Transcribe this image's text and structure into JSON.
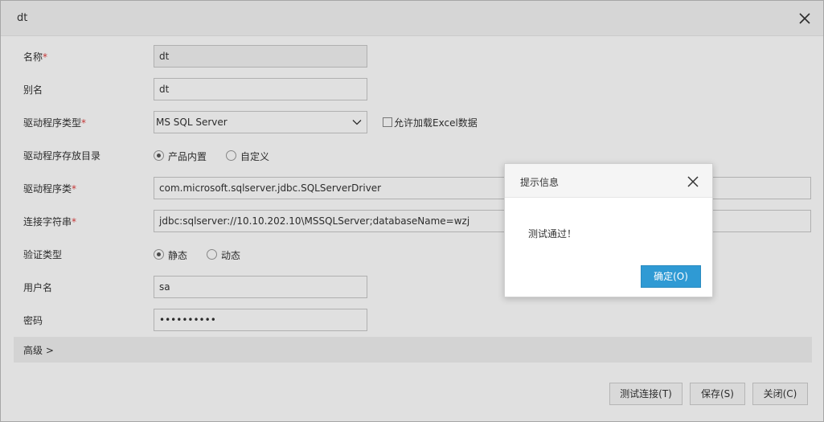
{
  "window": {
    "title": "dt"
  },
  "form": {
    "name": {
      "label": "名称",
      "required": "*",
      "value": "dt"
    },
    "alias": {
      "label": "别名",
      "value": "dt"
    },
    "driver_type": {
      "label": "驱动程序类型",
      "required": "*",
      "value": "MS SQL Server"
    },
    "allow_excel": {
      "label": "允许加载Excel数据",
      "checked": false
    },
    "driver_dir": {
      "label": "驱动程序存放目录",
      "options": [
        "产品内置",
        "自定义"
      ],
      "selected": "产品内置"
    },
    "driver_class": {
      "label": "驱动程序类",
      "required": "*",
      "value": "com.microsoft.sqlserver.jdbc.SQLServerDriver"
    },
    "conn_string": {
      "label": "连接字符串",
      "required": "*",
      "value": "jdbc:sqlserver://10.10.202.10\\MSSQLServer;databaseName=wzj"
    },
    "auth_type": {
      "label": "验证类型",
      "options": [
        "静态",
        "动态"
      ],
      "selected": "静态"
    },
    "username": {
      "label": "用户名",
      "value": "sa"
    },
    "password": {
      "label": "密码",
      "value": "••••••••••"
    },
    "advanced": {
      "label": "高级 >"
    }
  },
  "buttons": {
    "test": "测试连接(T)",
    "save": "保存(S)",
    "close": "关闭(C)"
  },
  "dialog": {
    "title": "提示信息",
    "message": "测试通过！",
    "ok": "确定(O)"
  },
  "colors": {
    "primary": "#2f9ad4",
    "required": "#e04040"
  }
}
